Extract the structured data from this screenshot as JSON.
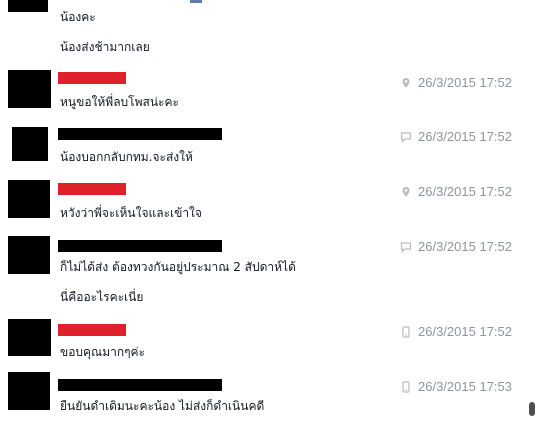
{
  "messages": [
    {
      "text": "น้องคะ"
    },
    {
      "text": "น้องส่งช้ามากเลย"
    },
    {
      "text": "หนูขอให้พี่ลบโพสน่ะคะ",
      "timestamp": "26/3/2015 17:52",
      "icon": "location-pin-icon"
    },
    {
      "text": "น้องบอกกลับกทม.จะส่งให้",
      "timestamp": "26/3/2015 17:52",
      "icon": "chat-bubble-icon"
    },
    {
      "text": "หวังว่าพี่จะเห็นใจและเข้าใจ",
      "timestamp": "26/3/2015 17:52",
      "icon": "location-pin-icon"
    },
    {
      "text": "ก็ไม่ได้ส่ง ต้องทวงกันอยู่ประมาณ 2 สัปดาห์ได้",
      "timestamp": "26/3/2015 17:52",
      "icon": "chat-bubble-icon"
    },
    {
      "text": "นี่คืออะไรคะเนี่ย"
    },
    {
      "text": "ขอบคุณมากๆค่ะ",
      "timestamp": "26/3/2015 17:52",
      "icon": "phone-icon"
    },
    {
      "text": "ยืนยันดำเดิมนะคะน้อง ไม่ส่งก็ดำเนินคดี",
      "timestamp": "26/3/2015 17:53",
      "icon": "phone-icon"
    }
  ],
  "colors": {
    "redaction_red": "#e0202a",
    "redaction_black": "#000000",
    "timestamp_gray": "#90949c"
  }
}
